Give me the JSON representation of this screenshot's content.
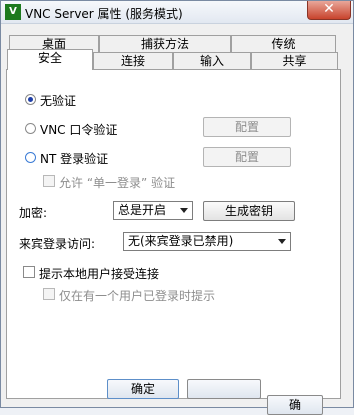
{
  "window": {
    "title": "VNC Server 属性 (服务模式)",
    "app_icon_glyph": "V",
    "close_glyph": "✕"
  },
  "tabs_row1": [
    "桌面",
    "捕获方法",
    "传统"
  ],
  "tabs_row2": [
    "安全",
    "连接",
    "输入",
    "共享"
  ],
  "active_tab": "安全",
  "auth": {
    "no_auth": "无验证",
    "vnc_password": "VNC 口令验证",
    "vnc_config_button": "配置",
    "nt_login": "NT 登录验证",
    "nt_config_button": "配置",
    "allow_single_login": "允许 “单一登录” 验证"
  },
  "encryption": {
    "label": "加密:",
    "value": "总是开启",
    "generate_key_button": "生成密钥"
  },
  "guest_login": {
    "label": "来宾登录访问:",
    "value": "无(来宾登录已禁用)"
  },
  "prompt": {
    "prompt_local_user": "提示本地用户接受连接",
    "only_when_logged_in": "仅在有一个用户已登录时提示"
  },
  "bottom_buttons": {
    "ok": "确定",
    "second": "",
    "third": "确"
  },
  "colors": {
    "selected_radio": "#1f3fa8",
    "nt_radio_border": "#3a7bd5",
    "close_button": "#c8432c"
  }
}
